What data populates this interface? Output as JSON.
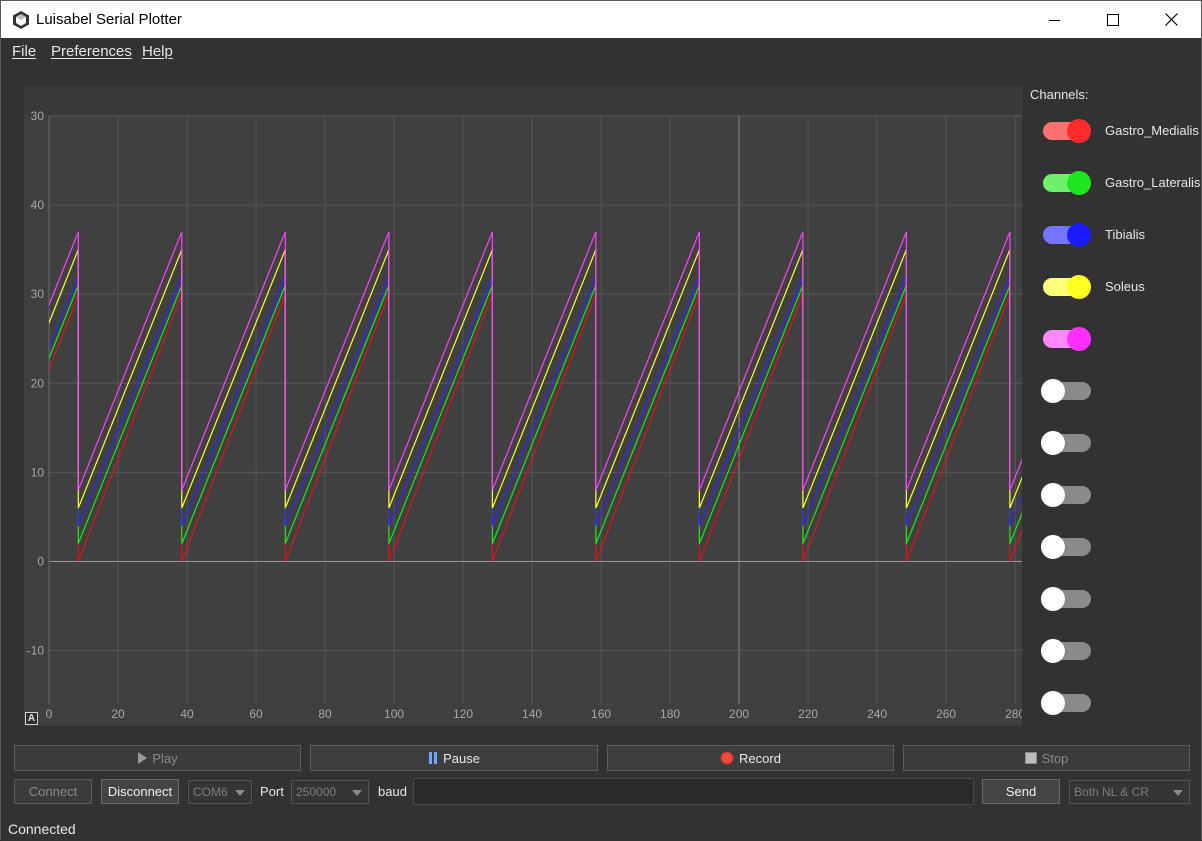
{
  "window": {
    "title": "Luisabel Serial Plotter",
    "icon": "hexagon-cube-icon",
    "controls": [
      "minimize-icon",
      "maximize-icon",
      "close-icon"
    ]
  },
  "menu": {
    "file": "File",
    "preferences": "Preferences",
    "help": "Help"
  },
  "plot": {
    "x_ticks": [
      "0",
      "20",
      "40",
      "60",
      "80",
      "100",
      "120",
      "140",
      "160",
      "180",
      "200",
      "220",
      "240",
      "260",
      "280"
    ],
    "y_ticks": [
      "30",
      "40",
      "30",
      "20",
      "10",
      "0",
      "-10"
    ],
    "autoscale_label": "A",
    "background": "#404040",
    "grid_color": "#575757"
  },
  "chart_data": {
    "type": "line",
    "xlim": [
      0,
      282
    ],
    "ylim": [
      -16,
      50
    ],
    "period": 30,
    "series": [
      {
        "name": "Gastro_Medialis",
        "color": "#e01414",
        "min": 0,
        "max": 30
      },
      {
        "name": "Gastro_Lateralis",
        "color": "#1ee61e",
        "min": 2,
        "max": 31
      },
      {
        "name": "Tibialis",
        "color": "#2828ff",
        "min": 4,
        "max": 32
      },
      {
        "name": "Soleus",
        "color": "#ffff30",
        "min": 6,
        "max": 35
      },
      {
        "name": "",
        "color": "#ff40ff",
        "min": 8,
        "max": 37
      }
    ]
  },
  "channels": {
    "label": "Channels:",
    "items": [
      {
        "name": "Gastro_Medialis",
        "on": true,
        "color": "#ff2a2a",
        "track": "#ff7070"
      },
      {
        "name": "Gastro_Lateralis",
        "on": true,
        "color": "#1ee61e",
        "track": "#6ef06e"
      },
      {
        "name": "Tibialis",
        "on": true,
        "color": "#1a1aff",
        "track": "#7474ff"
      },
      {
        "name": "Soleus",
        "on": true,
        "color": "#ffff20",
        "track": "#ffff7a"
      },
      {
        "name": "",
        "on": true,
        "color": "#ff30ff",
        "track": "#ff88ff"
      },
      {
        "name": "",
        "on": false
      },
      {
        "name": "",
        "on": false
      },
      {
        "name": "",
        "on": false
      },
      {
        "name": "",
        "on": false
      },
      {
        "name": "",
        "on": false
      },
      {
        "name": "",
        "on": false
      },
      {
        "name": "",
        "on": false
      }
    ]
  },
  "controls": {
    "play": "Play",
    "pause": "Pause",
    "record": "Record",
    "stop": "Stop",
    "connect": "Connect",
    "disconnect": "Disconnect",
    "com_port": "COM6",
    "port_label": "Port",
    "baud_value": "250000",
    "baud_label": "baud",
    "send": "Send",
    "line_ending": "Both NL & CR"
  },
  "status": {
    "text": "Connected"
  }
}
